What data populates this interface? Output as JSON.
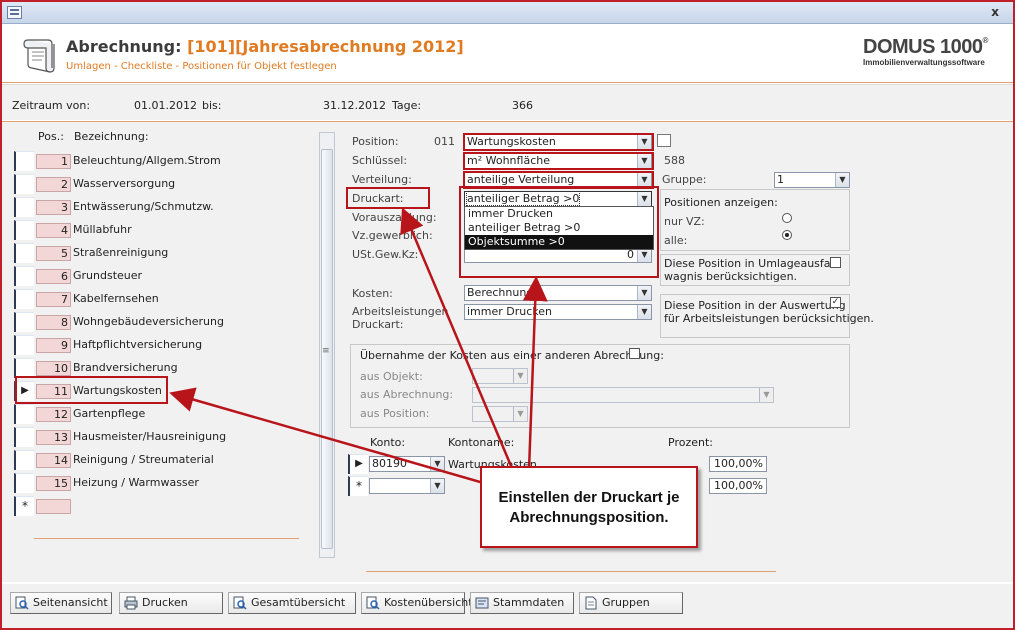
{
  "window": {
    "close_glyph": "x"
  },
  "header": {
    "title_prefix": "Abrechnung:",
    "title_highlight": "[101][Jahresabrechnung 2012]",
    "subtitle": "Umlagen - Checkliste - Positionen für Objekt festlegen",
    "logo_main": "DOMUS 1000",
    "logo_reg": "®",
    "logo_sub": "Immobilienverwaltungssoftware"
  },
  "period": {
    "from_label": "Zeitraum von:",
    "from_value": "01.01.2012",
    "to_label": "bis:",
    "to_value": "31.12.2012",
    "days_label": "Tage:",
    "days_value": "366"
  },
  "list": {
    "col_pos": "Pos.:",
    "col_name": "Bezeichnung:",
    "new_row_glyph": "*",
    "current_row_glyph": "▶",
    "rows": [
      {
        "pos": "1",
        "name": "Beleuchtung/Allgem.Strom"
      },
      {
        "pos": "2",
        "name": "Wasserversorgung"
      },
      {
        "pos": "3",
        "name": "Entwässerung/Schmutzw."
      },
      {
        "pos": "4",
        "name": "Müllabfuhr"
      },
      {
        "pos": "5",
        "name": "Straßenreinigung"
      },
      {
        "pos": "6",
        "name": "Grundsteuer"
      },
      {
        "pos": "7",
        "name": "Kabelfernsehen"
      },
      {
        "pos": "8",
        "name": "Wohngebäudeversicherung"
      },
      {
        "pos": "9",
        "name": "Haftpflichtversicherung"
      },
      {
        "pos": "10",
        "name": "Brandversicherung"
      },
      {
        "pos": "11",
        "name": "Wartungskosten"
      },
      {
        "pos": "12",
        "name": "Gartenpflege"
      },
      {
        "pos": "13",
        "name": "Hausmeister/Hausreinigung"
      },
      {
        "pos": "14",
        "name": "Reinigung / Streumaterial"
      },
      {
        "pos": "15",
        "name": "Heizung / Warmwasser"
      }
    ]
  },
  "detail": {
    "position_label": "Position:",
    "position_number": "011",
    "position_value": "Wartungskosten",
    "schluessel_label": "Schlüssel:",
    "schluessel_value": "m² Wohnfläche",
    "schluessel_number": "588",
    "verteilung_label": "Verteilung:",
    "verteilung_value": "anteilige Verteilung",
    "gruppe_label": "Gruppe:",
    "gruppe_value": "1",
    "druckart_label": "Druckart:",
    "druckart_value": "anteiliger Betrag >0",
    "druckart_options": [
      "immer Drucken",
      "anteiliger Betrag >0",
      "Objektsumme >0"
    ],
    "vorauszahlung_label": "Vorauszahlung:",
    "vz_gewerblich_label": "Vz.gewerblich:",
    "ust_label": "USt.Gew.Kz:",
    "ust_value": "0",
    "kosten_label": "Kosten:",
    "kosten_value": "Berechnung",
    "arbeits_label_1": "Arbeitsleistungen",
    "arbeits_label_2": "Druckart:",
    "arbeits_value": "immer Drucken",
    "positionen_anzeigen": "Positionen anzeigen:",
    "nur_vz": "nur VZ:",
    "alle": "alle:",
    "umlageausfall_1": "Diese Position in Umlageausfall",
    "umlageausfall_2": "wagnis berücksichtigen.",
    "auswertung_1": "Diese Position in der Auswertung",
    "auswertung_2": "für Arbeitsleistungen berücksichtigen.",
    "checked_glyph": "✓"
  },
  "uebernahme": {
    "title": "Übernahme der Kosten aus einer anderen Abrechnung:",
    "objekt_label": "aus Objekt:",
    "abrechnung_label": "aus Abrechnung:",
    "position_label": "aus Position:"
  },
  "konten": {
    "konto_label": "Konto:",
    "kontoname_label": "Kontoname:",
    "prozent_label": "Prozent:",
    "rows": [
      {
        "konto": "80190",
        "name": "Wartungskosten",
        "prozent": "100,00%"
      },
      {
        "konto": "",
        "name": "",
        "prozent": "100,00%"
      }
    ]
  },
  "callout": {
    "line1": "Einstellen der Druckart je",
    "line2": "Abrechnungsposition."
  },
  "toolbar": {
    "seitenansicht": "Seitenansicht",
    "drucken": "Drucken",
    "gesamtuebersicht": "Gesamtübersicht",
    "kostenuebersicht": "Kostenübersicht",
    "stammdaten": "Stammdaten",
    "gruppen": "Gruppen"
  },
  "colors": {
    "accent_orange": "#e07b22",
    "annotation_red": "#b8151b",
    "pos_field_bg": "#f3d6d6"
  },
  "icons": {
    "dropdown": "▼"
  }
}
